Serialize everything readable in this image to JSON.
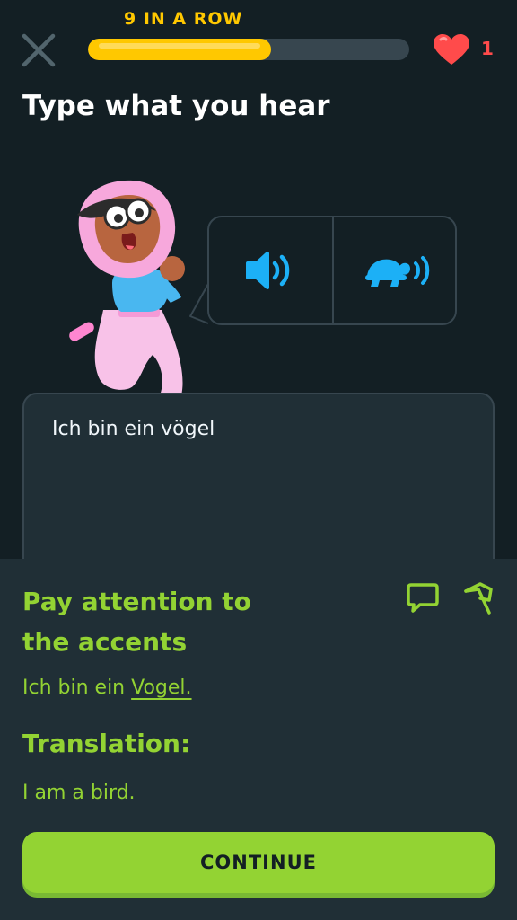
{
  "header": {
    "streak_label": "9 IN A ROW",
    "progress": 0.57,
    "lives": "1",
    "close_icon": "close-icon",
    "heart_icon": "heart-icon"
  },
  "exercise": {
    "title": "Type what you hear",
    "audio_normal_icon": "speaker-icon",
    "audio_slow_icon": "turtle-icon",
    "answer_value": "Ich bin ein vögel"
  },
  "feedback": {
    "heading_line1": "Pay attention to",
    "heading_line2": "the accents",
    "correct_prefix": "Ich bin ein ",
    "correct_highlight": "Vogel.",
    "translation_label": "Translation:",
    "translation_text": "I am a bird.",
    "continue_label": "CONTINUE",
    "comment_icon": "comment-icon",
    "flag_icon": "flag-icon"
  },
  "colors": {
    "background": "#131f24",
    "panel": "#202f36",
    "border": "#37464f",
    "streak": "#ffc800",
    "heart": "#ff4b4b",
    "success": "#93d333",
    "audio": "#1cb0f6"
  }
}
